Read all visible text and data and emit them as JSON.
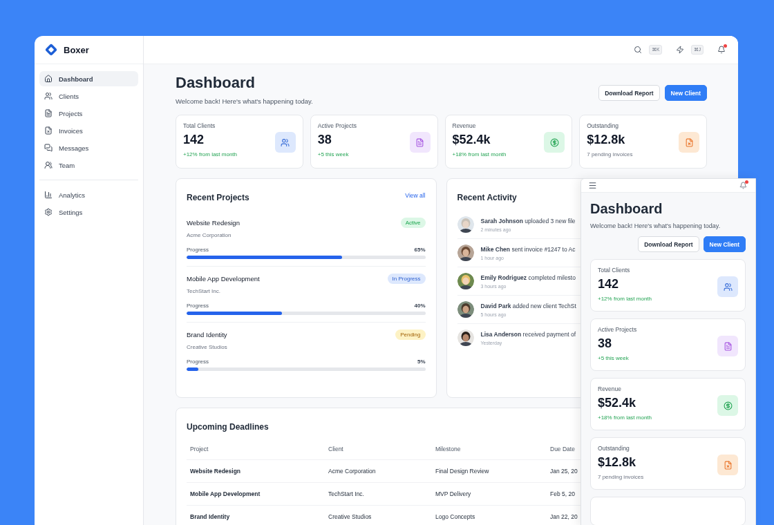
{
  "brand": {
    "name": "Boxer"
  },
  "sidebar": {
    "groups": [
      [
        {
          "label": "Dashboard",
          "selected": true
        },
        {
          "label": "Clients",
          "selected": false
        },
        {
          "label": "Projects",
          "selected": false
        },
        {
          "label": "Invoices",
          "selected": false
        },
        {
          "label": "Messages",
          "selected": false
        },
        {
          "label": "Team",
          "selected": false
        }
      ],
      [
        {
          "label": "Analytics",
          "selected": false
        },
        {
          "label": "Settings",
          "selected": false
        }
      ]
    ]
  },
  "topbar": {
    "search_shortcut": "⌘K",
    "action_shortcut": "⌘J",
    "notifications_unread": true
  },
  "header": {
    "title": "Dashboard",
    "subtitle": "Welcome back! Here's what's happening today.",
    "buttons": [
      {
        "label": "Download Report",
        "kind": "secondary"
      },
      {
        "label": "New Client",
        "kind": "primary"
      }
    ]
  },
  "stats": [
    {
      "kind": "clients",
      "label": "Total Clients",
      "value": "142",
      "note": "+12% from last month",
      "positive": true
    },
    {
      "kind": "projects",
      "label": "Active Projects",
      "value": "38",
      "note": "+5 this week",
      "positive": true
    },
    {
      "kind": "revenue",
      "label": "Revenue",
      "value": "$52.4k",
      "note": "+18% from last month",
      "positive": true
    },
    {
      "kind": "outstanding",
      "label": "Outstanding",
      "value": "$12.8k",
      "note": "7 pending invoices",
      "positive": false
    }
  ],
  "recent_projects": {
    "title": "Recent Projects",
    "link": "View all",
    "items": [
      {
        "name": "Website Redesign",
        "client": "Acme Corporation",
        "status": "Active",
        "kind": "active",
        "progress_label": "Progress",
        "percent": "65%",
        "level": 0.65
      },
      {
        "name": "Mobile App Development",
        "client": "TechStart Inc.",
        "status": "In Progress",
        "kind": "in_progress",
        "progress_label": "Progress",
        "percent": "40%",
        "level": 0.4
      },
      {
        "name": "Brand Identity",
        "client": "Creative Studios",
        "status": "Pending",
        "kind": "pending",
        "progress_label": "Progress",
        "percent": "5%",
        "level": 0.05
      }
    ]
  },
  "recent_activity": {
    "title": "Recent Activity",
    "items": [
      {
        "person": "Sarah Johnson",
        "action": " uploaded 3 new file",
        "time": "2 minutes ago"
      },
      {
        "person": "Mike Chen",
        "action": " sent invoice #1247 to Ac",
        "time": "1 hour ago"
      },
      {
        "person": "Emily Rodriguez",
        "action": " completed milesto",
        "time": "3 hours ago"
      },
      {
        "person": "David Park",
        "action": " added new client TechSt",
        "time": "5 hours ago"
      },
      {
        "person": "Lisa Anderson",
        "action": " received payment of",
        "time": "Yesterday"
      }
    ]
  },
  "deadlines": {
    "title": "Upcoming Deadlines",
    "columns": [
      "Project",
      "Client",
      "Milestone",
      "Due Date"
    ],
    "rows": [
      [
        "Website Redesign",
        "Acme Corporation",
        "Final Design Review",
        "Jan 25, 20"
      ],
      [
        "Mobile App Development",
        "TechStart Inc.",
        "MVP Delivery",
        "Feb 5, 20"
      ],
      [
        "Brand Identity",
        "Creative Studios",
        "Logo Concepts",
        "Jan 22, 20"
      ]
    ]
  },
  "mobile_preview": {
    "notifications_unread": true,
    "title": "Dashboard",
    "subtitle": "Welcome back! Here's what's happening today.",
    "buttons": [
      {
        "label": "Download Report",
        "kind": "secondary"
      },
      {
        "label": "New Client",
        "kind": "primary"
      }
    ],
    "stats": [
      {
        "kind": "clients",
        "label": "Total Clients",
        "value": "142",
        "note": "+12% from last month",
        "positive": true
      },
      {
        "kind": "projects",
        "label": "Active Projects",
        "value": "38",
        "note": "+5 this week",
        "positive": true
      },
      {
        "kind": "revenue",
        "label": "Revenue",
        "value": "$52.4k",
        "note": "+18% from last month",
        "positive": true
      },
      {
        "kind": "outstanding",
        "label": "Outstanding",
        "value": "$12.8k",
        "note": "7 pending invoices",
        "positive": false
      }
    ]
  }
}
